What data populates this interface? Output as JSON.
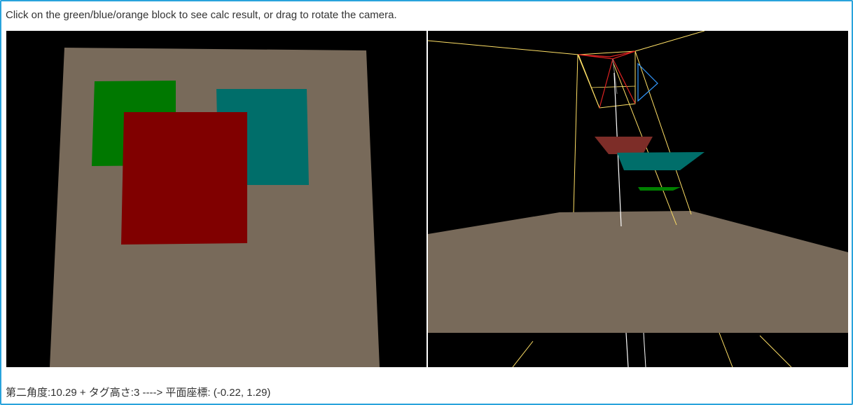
{
  "instructions": "Click on the green/blue/orange block to see calc result, or drag to rotate the camera.",
  "result_text": "第二角度:10.29 + タグ高さ:3 ----> 平面座標: (-0.22, 1.29)",
  "colors": {
    "background": "#000000",
    "plane": "#786a5a",
    "green_block": "#007800",
    "blue_block": "#006e6a",
    "red_block": "#800000",
    "frustum_line": "#ffe066",
    "ray_line": "#ffffff",
    "camera_red": "#dd2222",
    "camera_blue": "#3399ff",
    "frame_border": "#29a3dc"
  }
}
